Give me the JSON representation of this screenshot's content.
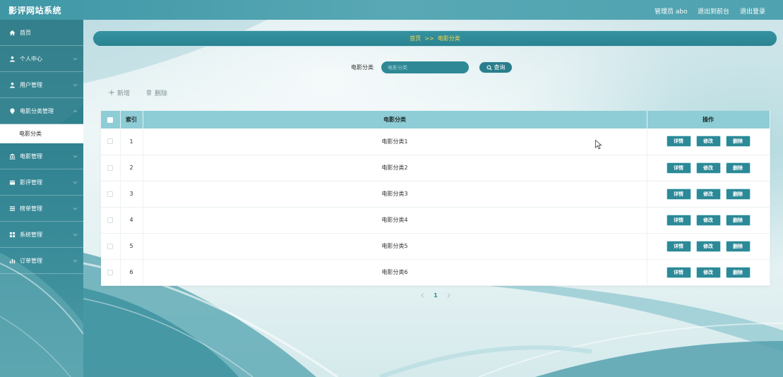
{
  "app": {
    "title": "影评网站系统"
  },
  "header": {
    "user_label": "管理员 abo",
    "front_link": "退出到前台",
    "logout_link": "退出登录"
  },
  "sidebar": {
    "items": [
      {
        "label": "首页",
        "icon": "home-icon"
      },
      {
        "label": "个人中心",
        "icon": "user-icon"
      },
      {
        "label": "用户管理",
        "icon": "user-icon"
      },
      {
        "label": "电影分类管理",
        "icon": "pin-icon",
        "expanded": true,
        "children": [
          {
            "label": "电影分类",
            "active": true
          }
        ]
      },
      {
        "label": "电影管理",
        "icon": "building-icon"
      },
      {
        "label": "影评管理",
        "icon": "card-icon"
      },
      {
        "label": "榜单管理",
        "icon": "list-icon"
      },
      {
        "label": "系统管理",
        "icon": "grid-icon"
      },
      {
        "label": "订单管理",
        "icon": "bar-chart-icon"
      }
    ]
  },
  "breadcrumb": {
    "home": "首页",
    "separator": ">>",
    "current": "电影分类"
  },
  "search": {
    "label": "电影分类",
    "placeholder": "电影分类",
    "value": "",
    "button_label": "查询",
    "button_icon": "search-icon"
  },
  "toolbar": {
    "add_label": "新增",
    "add_icon": "plus-icon",
    "delete_label": "删除",
    "delete_icon": "trash-icon"
  },
  "table": {
    "columns": {
      "index": "索引",
      "category": "电影分类",
      "actions": "操作"
    },
    "rows": [
      {
        "index": 1,
        "category": "电影分类1"
      },
      {
        "index": 2,
        "category": "电影分类2"
      },
      {
        "index": 3,
        "category": "电影分类3"
      },
      {
        "index": 4,
        "category": "电影分类4"
      },
      {
        "index": 5,
        "category": "电影分类5"
      },
      {
        "index": 6,
        "category": "电影分类6"
      }
    ],
    "row_actions": {
      "detail": "详情",
      "edit": "修改",
      "delete": "删除"
    }
  },
  "pagination": {
    "current_page": "1",
    "prev_icon": "chevron-left-icon",
    "next_icon": "chevron-right-icon"
  },
  "colors": {
    "header": "#4fa2b0",
    "sidebar": "#338593",
    "accent": "#2c8997",
    "breadcrumb_text": "#f3d64e",
    "table_header": "#8ecdd6"
  }
}
